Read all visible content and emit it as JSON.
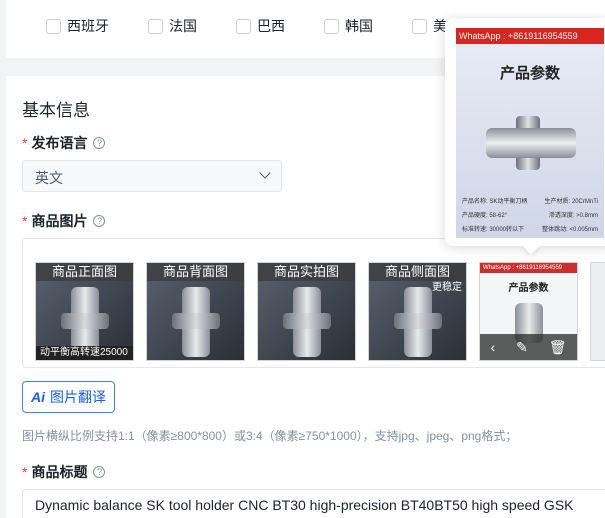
{
  "countries": [
    {
      "label": "西班牙",
      "checked": false
    },
    {
      "label": "法国",
      "checked": false
    },
    {
      "label": "巴西",
      "checked": false
    },
    {
      "label": "韩国",
      "checked": false
    },
    {
      "label": "美国",
      "checked": false
    }
  ],
  "basic_info": {
    "section_title": "基本信息",
    "language": {
      "label": "发布语言",
      "help": "?",
      "selected": "英文"
    },
    "images": {
      "label": "商品图片",
      "help": "?",
      "thumbnails": [
        {
          "caption": "商品正面图",
          "bottom_text": "动平衡高转速25000"
        },
        {
          "caption": "商品背面图",
          "bottom_text": ""
        },
        {
          "caption": "商品实拍图",
          "bottom_text": ""
        },
        {
          "caption": "商品侧面图",
          "bottom_text": "更稳定"
        },
        {
          "caption": "",
          "mini_header": "WhatsApp : +8619116954559",
          "mini_title": "产品参数"
        }
      ],
      "translate_button": {
        "icon_text": "Ai",
        "label": "图片翻译"
      },
      "hint": "图片横纵比例支持1:1（像素≥800*800）或3:4（像素≥750*1000），支持jpg、jpeg、png格式；"
    },
    "title": {
      "label": "商品标题",
      "help": "?",
      "value": "Dynamic balance SK tool holder CNC BT30 high-precision BT40BT50 high speed GSK"
    }
  },
  "preview_popover": {
    "watermark": "WhatsApp : +8619116954559",
    "title": "产品参数",
    "specs": [
      [
        "产品名称: SK动平衡刀柄",
        "生产材质: 20CrMnTi"
      ],
      [
        "产品硬度: 58-62°",
        "渗透深度: >0.8mm"
      ],
      [
        "标准转速: 30000转以下",
        "整体跳动: <0.005mm"
      ]
    ]
  }
}
